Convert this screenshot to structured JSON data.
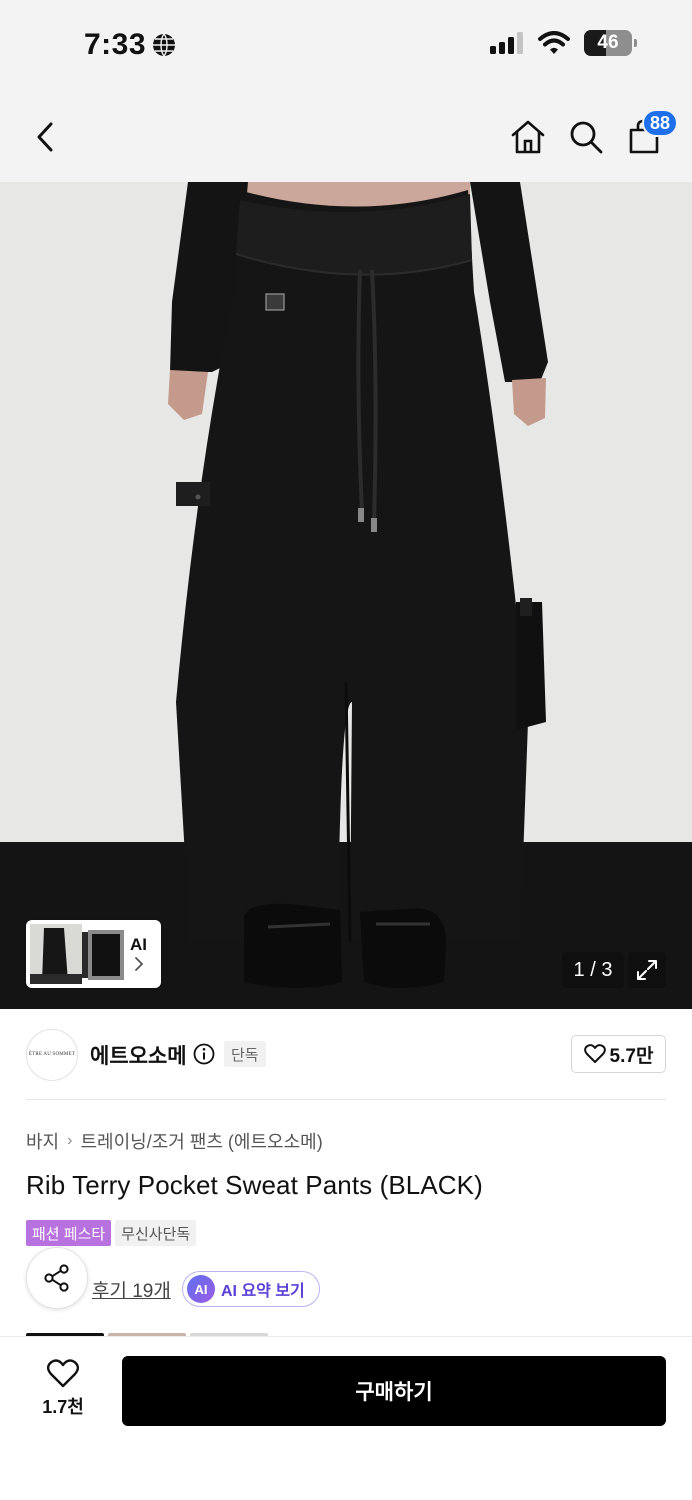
{
  "status_bar": {
    "time": "7:33",
    "battery": "46",
    "battery_level_percent": 46
  },
  "nav": {
    "cart_count": "88"
  },
  "hero": {
    "thumb_label": "AI",
    "page_counter": "1 / 3"
  },
  "brand": {
    "logo_text": "ÊTRE AU SOMMET",
    "name": "에트오소메",
    "badge": "단독",
    "like_count": "5.7만"
  },
  "product": {
    "breadcrumb": [
      "바지",
      "트레이닝/조거 팬츠 (에트오소메)"
    ],
    "title": "Rib Terry Pocket Sweat Pants (BLACK)",
    "tags": [
      "패션 페스타",
      "무신사단독"
    ],
    "review_link": "후기 19개",
    "ai_badge": "AI",
    "ai_summary_label": "AI 요약 보기"
  },
  "bottom_bar": {
    "like_count": "1.7천",
    "buy_label": "구매하기"
  },
  "colors": {
    "accent_blue": "#1f6feb",
    "tag_purple": "#b772e0",
    "buy_button": "#000000",
    "ai_purple": "#5b3fd6"
  }
}
